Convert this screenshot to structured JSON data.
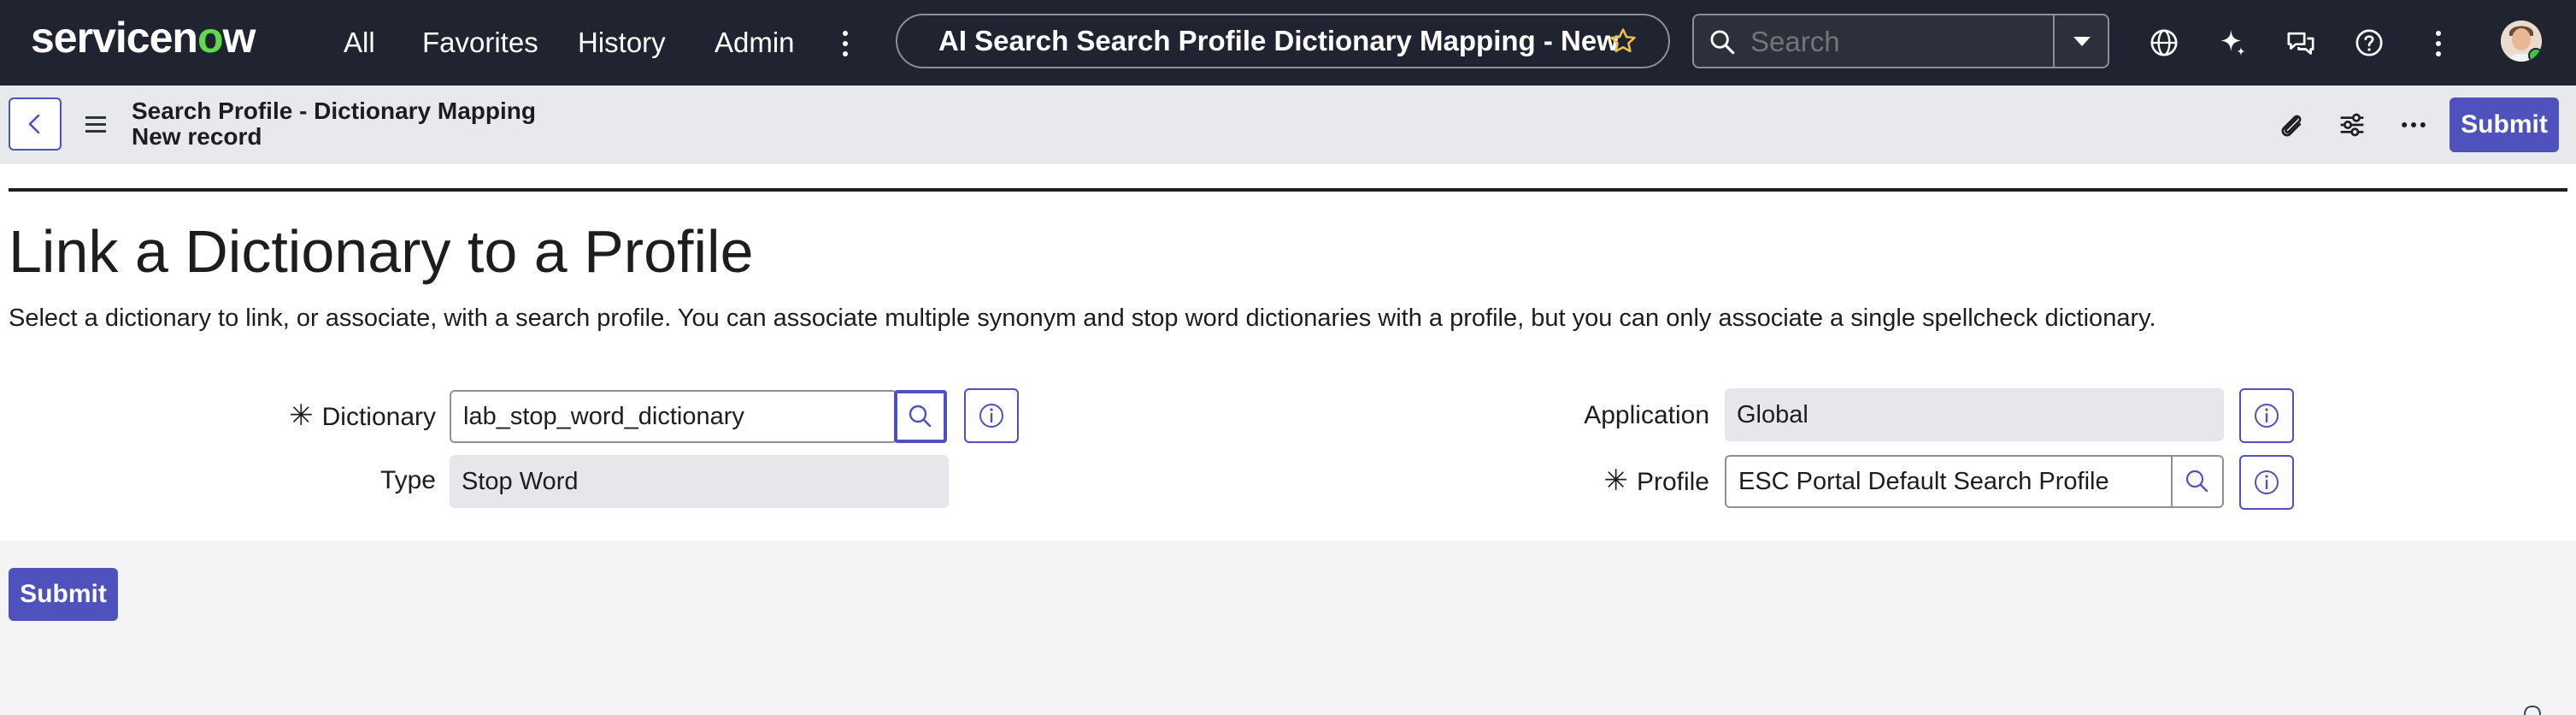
{
  "nav": {
    "logo": {
      "main": "servicen",
      "accent": "o",
      "tail": "w"
    },
    "links": [
      "All",
      "Favorites",
      "History",
      "Admin"
    ],
    "record_title": "AI Search Search Profile Dictionary Mapping - New ...",
    "search_placeholder": "Search"
  },
  "record_header": {
    "title": "Search Profile - Dictionary Mapping",
    "subtitle": "New record",
    "submit_label": "Submit"
  },
  "form": {
    "heading": "Link a Dictionary to a Profile",
    "description": "Select a dictionary to link, or associate, with a search profile. You can associate multiple synonym and stop word dictionaries with a profile, but you can only associate a single spellcheck dictionary.",
    "fields": {
      "dictionary": {
        "label": "Dictionary",
        "required": "✳",
        "value": "lab_stop_word_dictionary"
      },
      "type": {
        "label": "Type",
        "value": "Stop Word"
      },
      "application": {
        "label": "Application",
        "value": "Global"
      },
      "profile": {
        "label": "Profile",
        "required": "✳",
        "value": "ESC Portal Default Search Profile"
      }
    },
    "submit_label": "Submit"
  },
  "colors": {
    "nav_bg": "#1f2430",
    "accent": "#4f52bd",
    "logo_green": "#62d84e"
  },
  "icons": [
    "star-icon",
    "search-icon",
    "chevron-down-icon",
    "globe-icon",
    "sparkle-icon",
    "chat-icon",
    "help-icon",
    "more-vertical-icon",
    "back-arrow-icon",
    "menu-icon",
    "attachment-icon",
    "settings-sliders-icon",
    "more-horizontal-icon",
    "info-icon"
  ]
}
